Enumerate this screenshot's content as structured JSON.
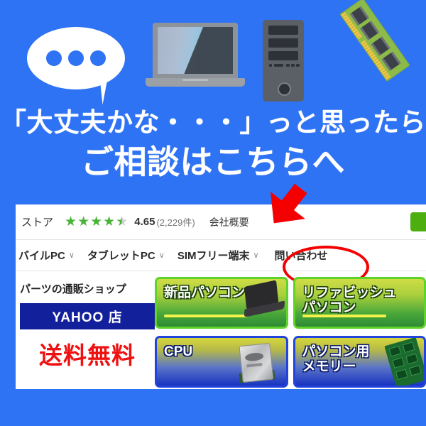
{
  "banner": {
    "background_color": "#2f73f5",
    "icons": [
      {
        "name": "speech-bubble-icon",
        "color": "#ffffff"
      },
      {
        "name": "laptop-icon",
        "color": "#8e9399"
      },
      {
        "name": "desktop-tower-icon",
        "color": "#5b6067"
      },
      {
        "name": "memory-module-icon",
        "color": "#8dbb4a"
      }
    ],
    "headline_line1": "「大丈夫かな・・・」っと思ったら",
    "headline_line2": "ご相談はこちらへ",
    "headline_color": "#ffffff"
  },
  "screenshot": {
    "store_bar": {
      "store_name": "ストア",
      "rating_value": "4.65",
      "rating_count": "(2,229件)",
      "stars_filled": 4,
      "stars_half": 1,
      "star_color": "#49b337",
      "company_link": "会社概要",
      "cart_button_color": "#4caf0f"
    },
    "nav": {
      "items": [
        {
          "label": "バイルPC",
          "has_caret": true,
          "highlighted": false
        },
        {
          "label": "タブレットPC",
          "has_caret": true,
          "highlighted": false
        },
        {
          "label": "SIMフリー端末",
          "has_caret": true,
          "highlighted": false
        },
        {
          "label": "問い合わせ",
          "has_caret": false,
          "highlighted": true
        }
      ],
      "caret_glyph": "∨"
    },
    "annotation": {
      "arrow_color": "#f50000",
      "circle_color": "#f50000",
      "circled_target": "問い合わせ"
    },
    "left_column": {
      "tagline": "パーツの通販ショップ",
      "store_badge": "YAHOO 店",
      "store_badge_bg": "#13209b",
      "shipping_text": "送料無料",
      "shipping_color": "#ee1111"
    },
    "tiles": [
      {
        "label": "新品パソコン",
        "theme": "green",
        "art": "laptop-art"
      },
      {
        "label": "リファビッシュ\nパソコン",
        "theme": "green",
        "art": "none"
      },
      {
        "label": "CPU",
        "theme": "blue",
        "art": "cpu-art"
      },
      {
        "label": "パソコン用\nメモリー",
        "theme": "blue",
        "art": "ram-art"
      }
    ]
  }
}
